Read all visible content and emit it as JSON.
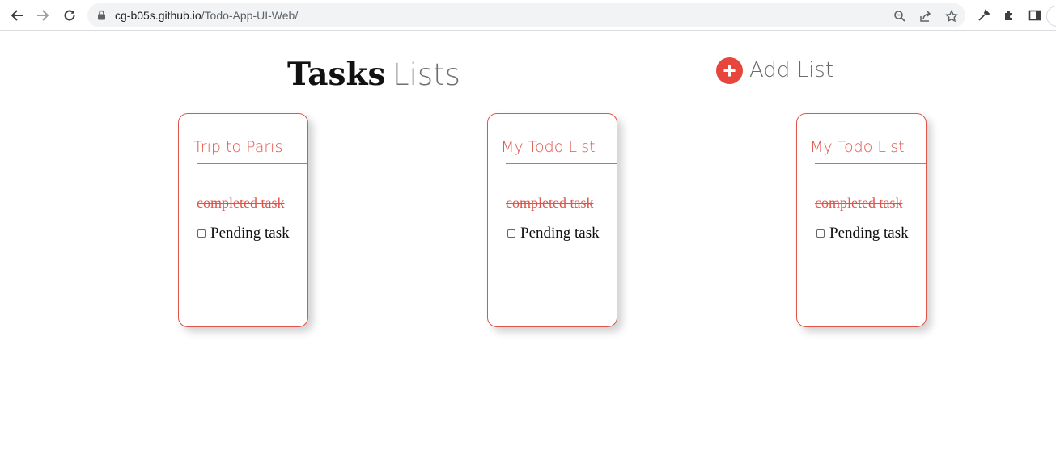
{
  "browser": {
    "url_host": "cg-b05s.github.io",
    "url_path": "/Todo-App-UI-Web/",
    "icons": [
      "back-icon",
      "forward-icon",
      "reload-icon",
      "lock-icon",
      "zoom-icon",
      "share-icon",
      "bookmark-star-icon",
      "eyedropper-icon",
      "extensions-icon",
      "side-panel-icon"
    ]
  },
  "header": {
    "title_bold": "Tasks",
    "title_light": "Lists",
    "add_list_label": "Add List"
  },
  "colors": {
    "accent": "#e0544b",
    "add_button": "#e8453c"
  },
  "lists": [
    {
      "title": "Trip to Paris",
      "completed_task": "completed task",
      "pending_task": "Pending task"
    },
    {
      "title": "My Todo List",
      "completed_task": "completed task",
      "pending_task": "Pending task"
    },
    {
      "title": "My Todo List",
      "completed_task": "completed task",
      "pending_task": "Pending task"
    }
  ]
}
